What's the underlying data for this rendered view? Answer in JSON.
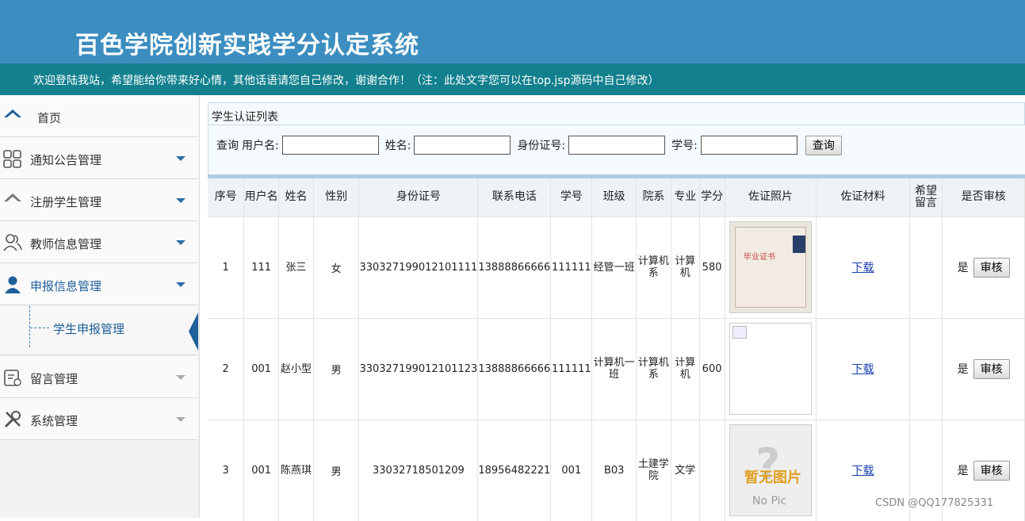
{
  "header": {
    "title": "百色学院创新实践学分认定系统"
  },
  "banner": {
    "text": "欢迎登陆我站，希望能给你带来好心情，其他话语请您自己修改，谢谢合作！（注：此处文字您可以在top.jsp源码中自己修改）"
  },
  "sidebar": {
    "items": [
      {
        "label": "首页",
        "icon": "home-icon"
      },
      {
        "label": "通知公告管理",
        "icon": "grid-icon"
      },
      {
        "label": "注册学生管理",
        "icon": "home-outline-icon"
      },
      {
        "label": "教师信息管理",
        "icon": "users-icon"
      },
      {
        "label": "申报信息管理",
        "icon": "user-icon"
      },
      {
        "label": "留言管理",
        "icon": "message-icon"
      },
      {
        "label": "系统管理",
        "icon": "tools-icon"
      }
    ],
    "submenu": {
      "label": "学生申报管理"
    }
  },
  "panel": {
    "title": "学生认证列表"
  },
  "search": {
    "query_label": "查询",
    "username_label": "用户名:",
    "name_label": "姓名:",
    "idcard_label": "身份证号:",
    "studentno_label": "学号:",
    "button": "查询"
  },
  "table": {
    "headers": [
      "序号",
      "用户名",
      "姓名",
      "性别",
      "身份证号",
      "联系电话",
      "学号",
      "班级",
      "院系",
      "专业",
      "学分",
      "佐证照片",
      "佐证材料",
      "希望留言",
      "是否审核"
    ],
    "rows": [
      {
        "no": "1",
        "username": "111",
        "name": "张三",
        "gender": "女",
        "idcard": "330327199012101111",
        "phone": "13888866666",
        "studentno": "111111",
        "class": "经管一班",
        "dept": "计算机系",
        "major": "计算机",
        "credit": "580",
        "photo": "certificate",
        "download": "下载",
        "message": "",
        "audited": "是",
        "audit_btn": "审核"
      },
      {
        "no": "2",
        "username": "001",
        "name": "赵小型",
        "gender": "男",
        "idcard": "330327199012101123",
        "phone": "13888866666",
        "studentno": "111111",
        "class": "计算机一班",
        "dept": "计算机系",
        "major": "计算机",
        "credit": "600",
        "photo": "broken",
        "download": "下载",
        "message": "",
        "audited": "是",
        "audit_btn": "审核"
      },
      {
        "no": "3",
        "username": "001",
        "name": "陈燕琪",
        "gender": "男",
        "idcard": "33032718501209",
        "phone": "18956482221",
        "studentno": "001",
        "class": "B03",
        "dept": "土建学院",
        "major": "文学",
        "credit": "",
        "photo": "nopic",
        "download": "下载",
        "message": "",
        "audited": "是",
        "audit_btn": "审核"
      }
    ],
    "cert_text": "毕业证书",
    "nopic_text": "暂无图片",
    "nopic_sub": "No Pic"
  },
  "watermark": "CSDN @QQ177825331",
  "colors": {
    "header": "#3c8dc0",
    "banner": "#12808e",
    "accent": "#1f5f9a"
  }
}
